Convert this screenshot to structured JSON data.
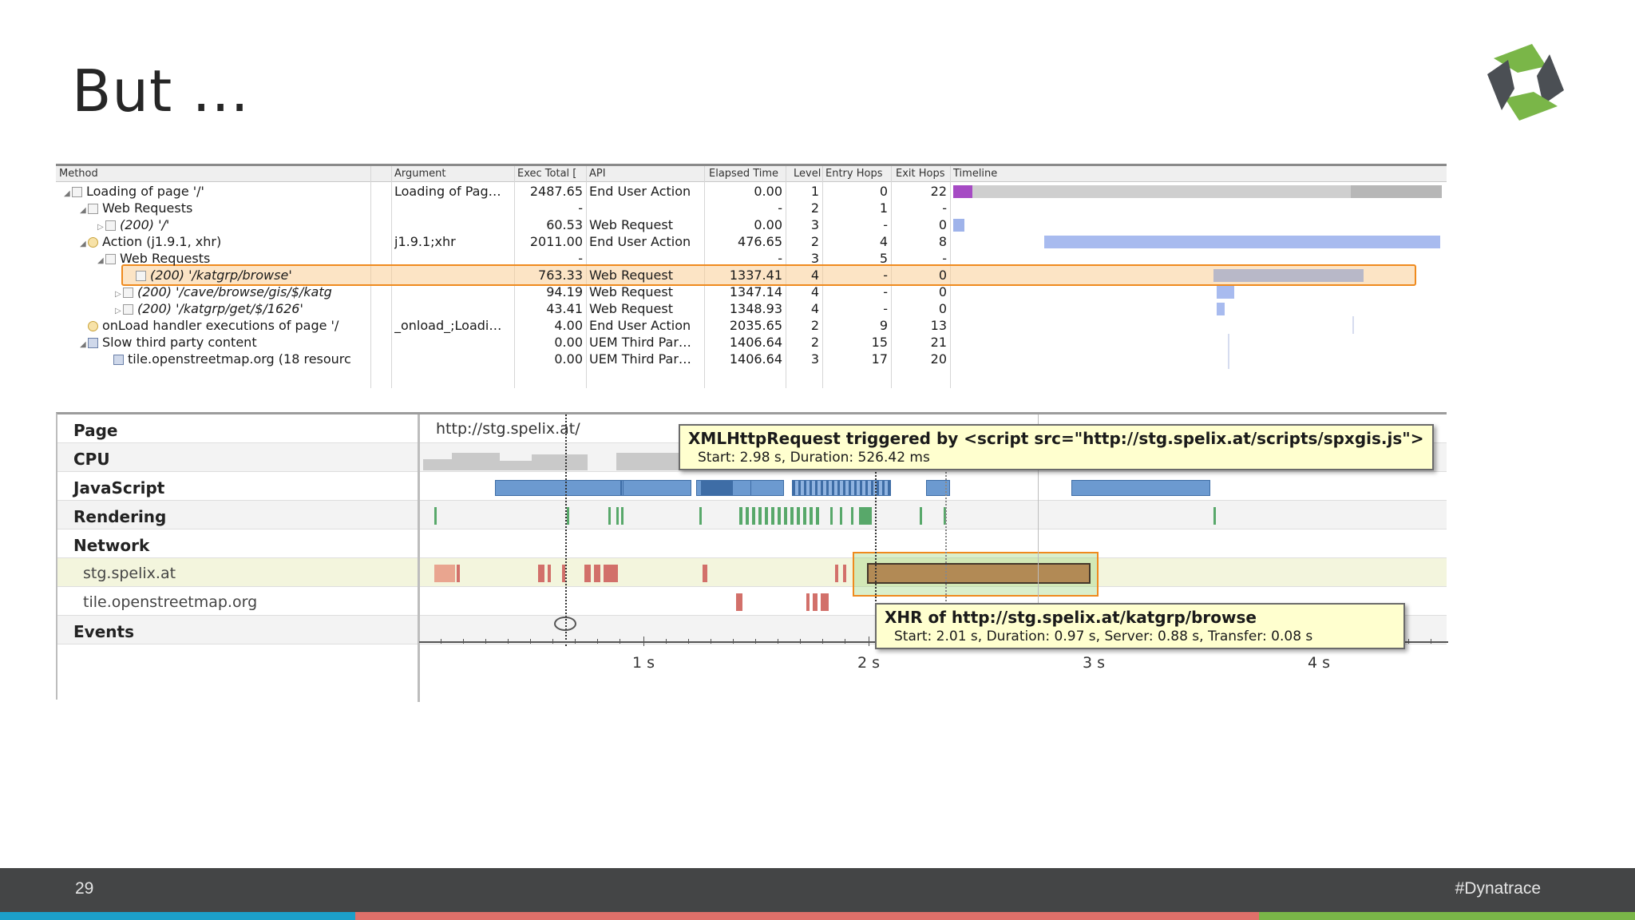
{
  "slide": {
    "title": "But …",
    "page_number": "29",
    "hashtag": "#Dynatrace"
  },
  "purepath": {
    "columns": [
      "Method",
      "Argument",
      "Exec Total [",
      "API",
      "Elapsed Time",
      "Level",
      "Entry Hops",
      "Exit Hops",
      "Timeline"
    ],
    "rows": [
      {
        "method": "Loading of page '/'",
        "argument": "Loading of Pag…",
        "exec_total": "2487.65",
        "api": "End User Action",
        "elapsed": "0.00",
        "level": "1",
        "entry": "0",
        "exit": "22",
        "selected": false
      },
      {
        "method": "Web Requests",
        "argument": "",
        "exec_total": "-",
        "api": "",
        "elapsed": "-",
        "level": "2",
        "entry": "1",
        "exit": "-",
        "selected": false
      },
      {
        "method": "(200) '/'",
        "argument": "",
        "exec_total": "60.53",
        "api": "Web Request",
        "elapsed": "0.00",
        "level": "3",
        "entry": "-",
        "exit": "0",
        "selected": false
      },
      {
        "method": "Action (j1.9.1, xhr)",
        "argument": "j1.9.1;xhr",
        "exec_total": "2011.00",
        "api": "End User Action",
        "elapsed": "476.65",
        "level": "2",
        "entry": "4",
        "exit": "8",
        "selected": false
      },
      {
        "method": "Web Requests",
        "argument": "",
        "exec_total": "-",
        "api": "",
        "elapsed": "-",
        "level": "3",
        "entry": "5",
        "exit": "-",
        "selected": false
      },
      {
        "method": "(200) '/katgrp/browse'",
        "argument": "",
        "exec_total": "763.33",
        "api": "Web Request",
        "elapsed": "1337.41",
        "level": "4",
        "entry": "-",
        "exit": "0",
        "selected": true
      },
      {
        "method": "(200) '/cave/browse/gis/$/katg",
        "argument": "",
        "exec_total": "94.19",
        "api": "Web Request",
        "elapsed": "1347.14",
        "level": "4",
        "entry": "-",
        "exit": "0",
        "selected": false
      },
      {
        "method": "(200) '/katgrp/get/$/1626'",
        "argument": "",
        "exec_total": "43.41",
        "api": "Web Request",
        "elapsed": "1348.93",
        "level": "4",
        "entry": "-",
        "exit": "0",
        "selected": false
      },
      {
        "method": "onLoad handler executions of page '/",
        "argument": "_onload_;Loadi…",
        "exec_total": "4.00",
        "api": "End User Action",
        "elapsed": "2035.65",
        "level": "2",
        "entry": "9",
        "exit": "13",
        "selected": false
      },
      {
        "method": "Slow third party content",
        "argument": "",
        "exec_total": "0.00",
        "api": "UEM Third Par…",
        "elapsed": "1406.64",
        "level": "2",
        "entry": "15",
        "exit": "21",
        "selected": false
      },
      {
        "method": "tile.openstreetmap.org (18 resourc",
        "argument": "",
        "exec_total": "0.00",
        "api": "UEM Third Par…",
        "elapsed": "1406.64",
        "level": "3",
        "entry": "17",
        "exit": "20",
        "selected": false
      }
    ]
  },
  "timeline": {
    "rows": [
      "Page",
      "CPU",
      "JavaScript",
      "Rendering",
      "Network",
      "stg.spelix.at",
      "tile.openstreetmap.org",
      "Events"
    ],
    "page_url": "http://stg.spelix.at/",
    "axis_labels": [
      "1 s",
      "2 s",
      "3 s",
      "4 s"
    ],
    "tooltip_script": {
      "title": "XMLHttpRequest triggered by <script src=\"http://stg.spelix.at/scripts/spxgis.js\">",
      "detail": "Start: 2.98 s, Duration: 526.42 ms"
    },
    "tooltip_xhr": {
      "title": "XHR of http://stg.spelix.at/katgrp/browse",
      "detail": "Start: 2.01 s, Duration: 0.97 s, Server: 0.88 s, Transfer: 0.08 s"
    }
  },
  "colors": {
    "footer_bg": "#444546",
    "strip_blue": "#1c9fc9",
    "strip_red": "#e0706a",
    "strip_green": "#7ab648",
    "highlight_orange": "#ef8a1e",
    "logo_green": "#7ab648",
    "logo_gray": "#4b4f54"
  }
}
